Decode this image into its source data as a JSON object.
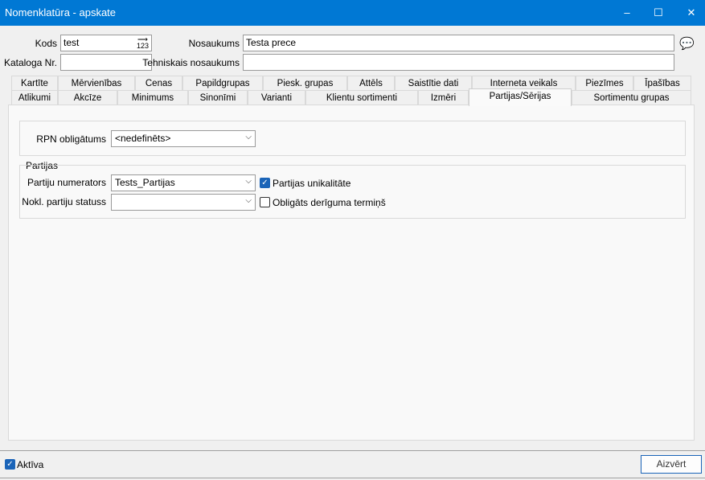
{
  "window": {
    "title": "Nomenklatūra - apskate",
    "minimize": "–",
    "maximize": "☐",
    "close": "✕"
  },
  "header": {
    "kods_label": "Kods",
    "kods_value": "test",
    "counter_icon": "123",
    "nosaukums_label": "Nosaukums",
    "nosaukums_value": "Testa prece",
    "kataloga_label": "Kataloga Nr.",
    "kataloga_value": "",
    "tehniskais_label": "Tehniskais nosaukums",
    "tehniskais_value": ""
  },
  "tabs_row1": [
    "Kartīte",
    "Mērvienības",
    "Cenas",
    "Papildgrupas",
    "Piesk. grupas",
    "Attēls",
    "Saistītie dati",
    "Interneta veikals",
    "Piezīmes",
    "Īpašības"
  ],
  "tabs_row2": [
    "Atlikumi",
    "Akcīze",
    "Minimums",
    "Sinonīmi",
    "Varianti",
    "Klientu sortimenti",
    "Izmēri",
    "Partijas/Sērijas",
    "Sortimentu grupas"
  ],
  "active_tab": "Partijas/Sērijas",
  "rpn": {
    "label": "RPN obligātums",
    "value": "<nedefinēts>"
  },
  "partijas": {
    "group_title": "Partijas",
    "numerators_label": "Partiju numerators",
    "numerators_value": "Tests_Partijas",
    "statuss_label": "Nokl. partiju statuss",
    "statuss_value": "",
    "unikalitate_label": "Partijas unikalitāte",
    "unikalitate_checked": true,
    "termins_label": "Obligāts derīguma termiņš",
    "termins_checked": false
  },
  "footer": {
    "aktiva_label": "Aktīva",
    "aktiva_checked": true,
    "close_label": "Aizvērt"
  },
  "colors": {
    "titlebar": "#0078d4",
    "checkbox": "#1a64b8"
  }
}
